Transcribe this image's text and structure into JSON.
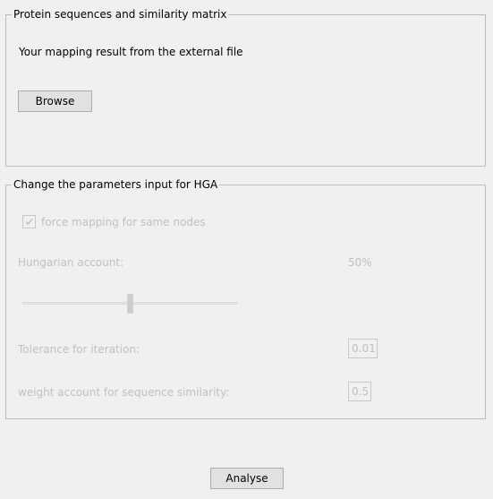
{
  "protein_group": {
    "title": "Protein sequences and similarity matrix",
    "mapping_label": "Your mapping result from the external file",
    "browse_label": "Browse"
  },
  "hga_group": {
    "title": "Change the parameters input for HGA",
    "force_mapping_label": "force mapping for same nodes",
    "force_mapping_checked": true,
    "hungarian_label": "Hungarian account:",
    "hungarian_value": "50%",
    "hungarian_slider_fraction": 0.5,
    "tolerance_label": "Tolerance for iteration:",
    "tolerance_value": "0.01",
    "weight_label": "weight account for sequence similarity:",
    "weight_value": "0.5"
  },
  "actions": {
    "analyse_label": "Analyse"
  },
  "colors": {
    "background": "#f0f0f0",
    "disabled_text": "#c0c0c0",
    "border": "#bcbcbc"
  }
}
